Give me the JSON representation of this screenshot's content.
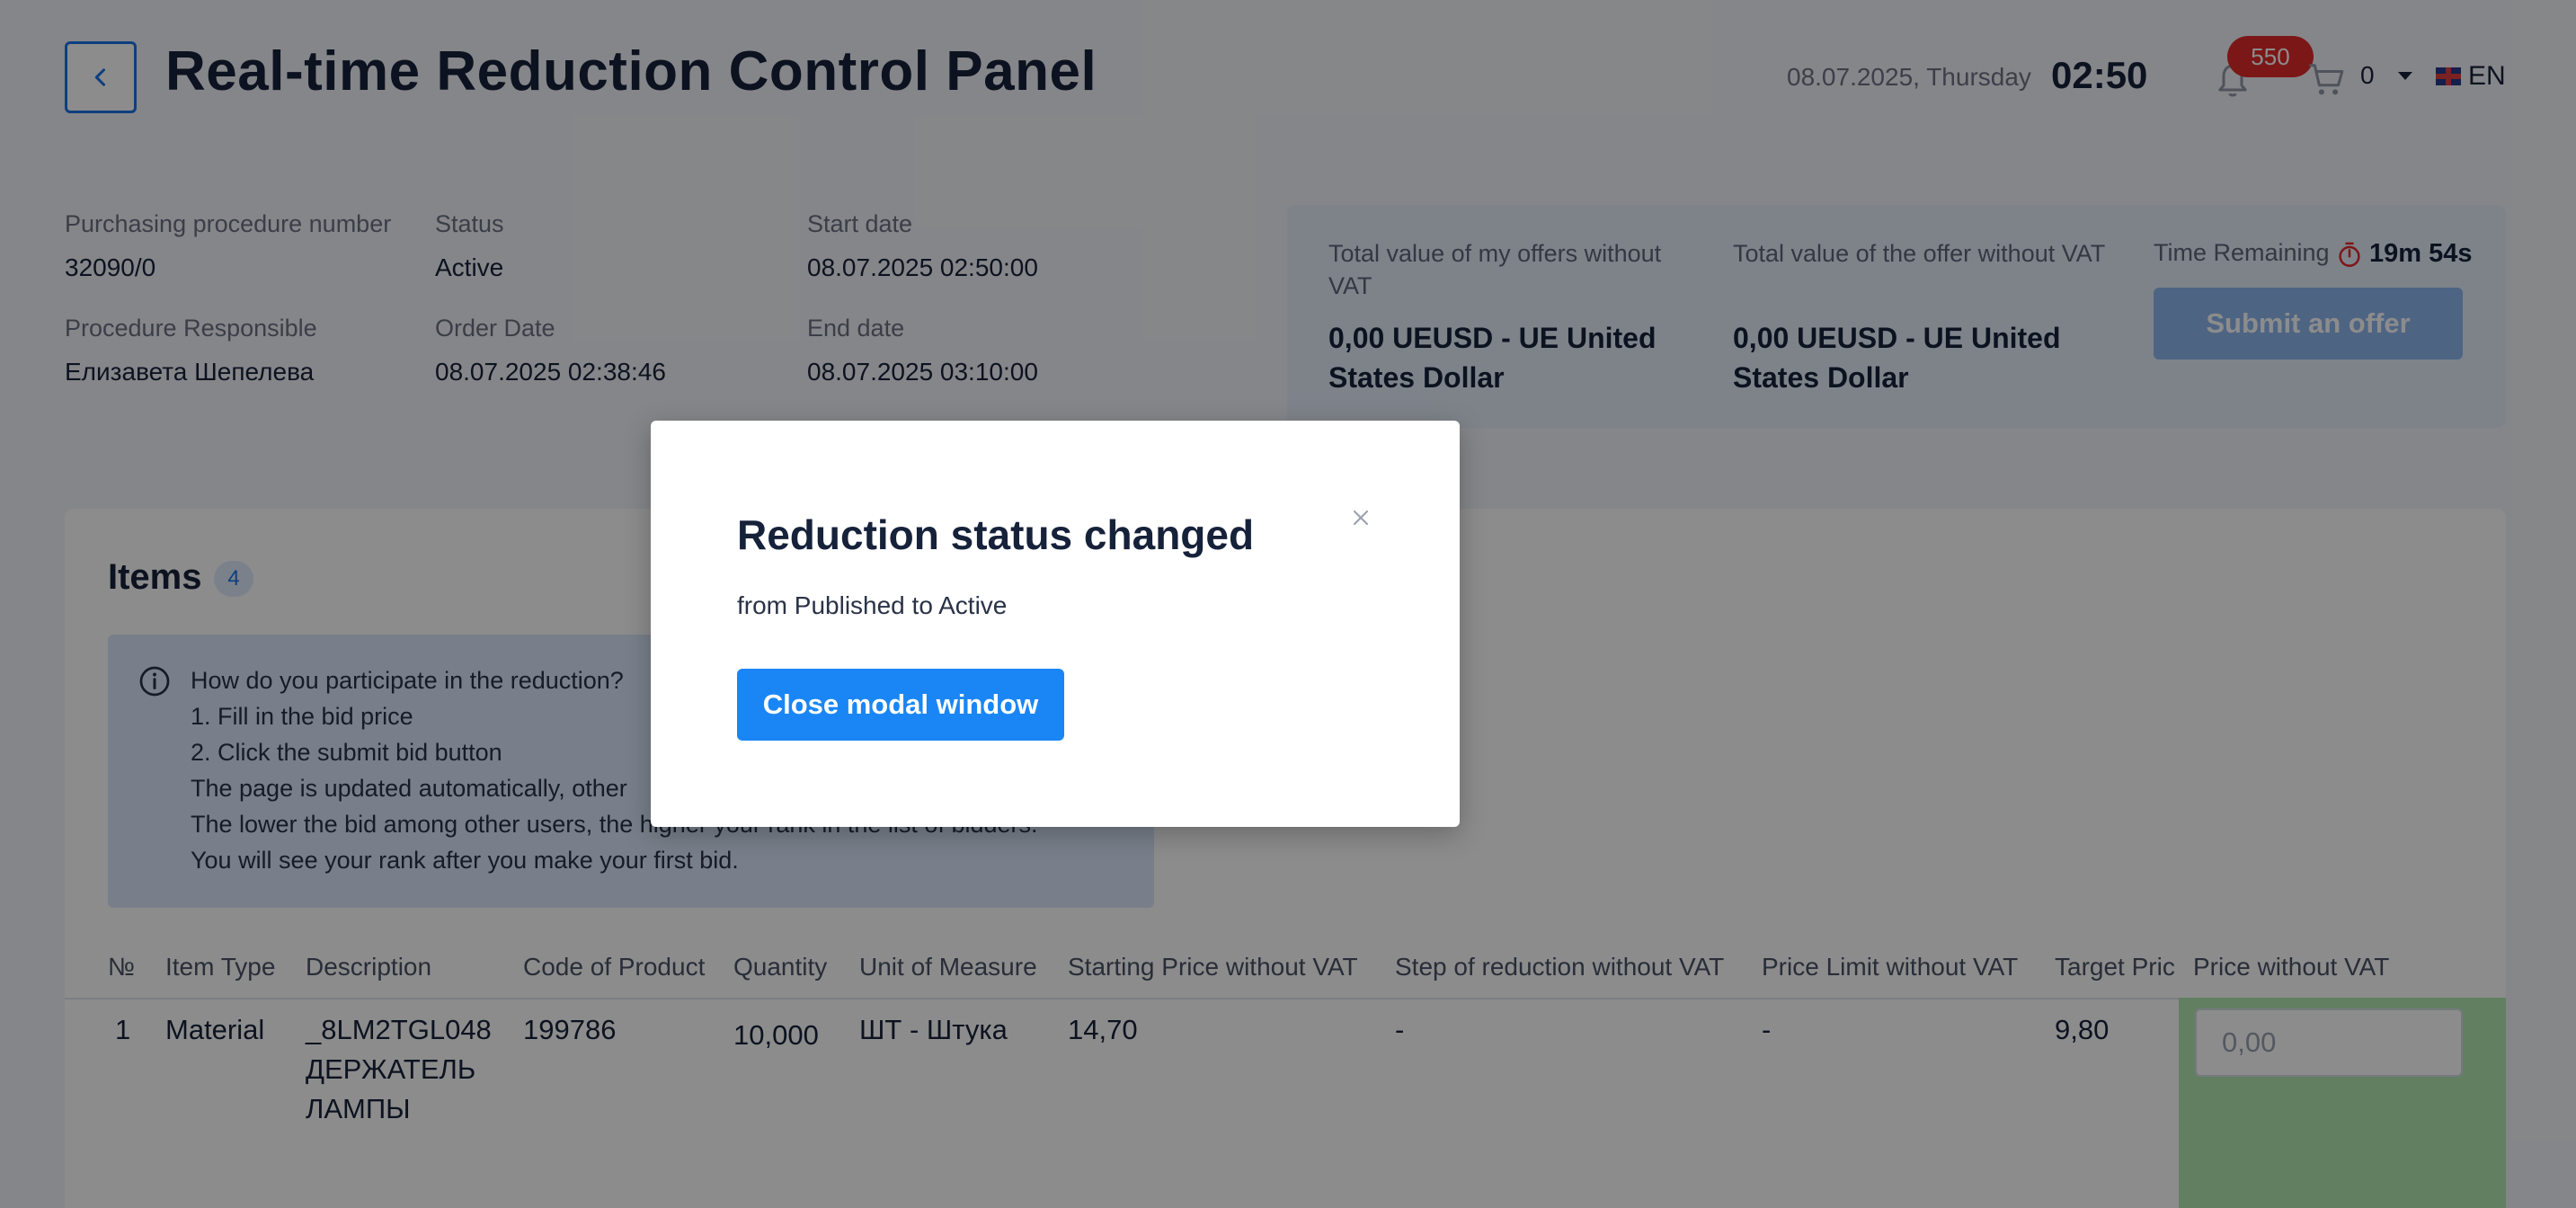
{
  "header": {
    "title": "Real-time Reduction Control Panel",
    "date": "08.07.2025, Thursday",
    "time": "02:50",
    "notifications_count": "550",
    "cart_count": "0",
    "language": "EN"
  },
  "procedure": {
    "number_label": "Purchasing procedure number",
    "number_value": "32090/0",
    "status_label": "Status",
    "status_value": "Active",
    "start_label": "Start date",
    "start_value": "08.07.2025 02:50:00",
    "responsible_label": "Procedure Responsible",
    "responsible_value": "Елизавета Шепелева",
    "order_label": "Order Date",
    "order_value": "08.07.2025 02:38:46",
    "end_label": "End date",
    "end_value": "08.07.2025 03:10:00"
  },
  "summary": {
    "my_offers_label": "Total value of my offers without VAT",
    "my_offers_value": "0,00 UEUSD - UE United States Dollar",
    "offer_label": "Total value of the offer without VAT",
    "offer_value": "0,00 UEUSD - UE United States Dollar",
    "time_remaining_label": "Time Remaining",
    "time_remaining_value": "19m 54s",
    "submit_label": "Submit an offer"
  },
  "items": {
    "title": "Items",
    "count": "4",
    "help": [
      "How do you participate in the reduction?",
      "1. Fill in the bid price",
      "2. Click the submit bid button",
      "The page is updated automatically, other",
      "The lower the bid among other users, the higher your rank in the list of bidders.",
      "You will see your rank after you make your first bid."
    ],
    "columns": [
      "№",
      "Item Type",
      "Description",
      "Code of Product",
      "Quantity",
      "Unit of Measure",
      "Starting Price without VAT",
      "Step of reduction without VAT",
      "Price Limit without VAT",
      "Target Pric",
      "Price without VAT"
    ],
    "rows": [
      {
        "no": "1",
        "type": "Material",
        "description": [
          "_8LM2TGL048",
          "ДЕРЖАТЕЛЬ",
          "ЛАМПЫ"
        ],
        "code": "199786",
        "quantity": "10,000",
        "unit": "ШТ - Штука",
        "start_price": "14,70",
        "step": "-",
        "limit": "-",
        "target": "9,80",
        "price_placeholder": "0,00"
      }
    ]
  },
  "modal": {
    "title": "Reduction status changed",
    "text": "from Published to Active",
    "button": "Close modal window"
  },
  "colors": {
    "accent": "#1a86f5",
    "badge": "#e02b2b",
    "timer": "#e02b2b",
    "price_column": "#b5e7b2"
  }
}
